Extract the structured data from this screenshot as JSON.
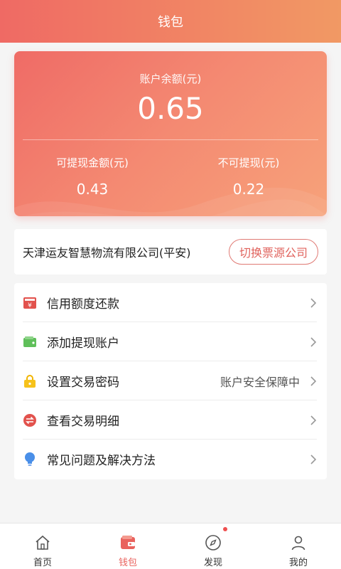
{
  "header": {
    "title": "钱包"
  },
  "card": {
    "balance_label": "账户余额(元)",
    "balance": "0.65",
    "withdrawable_label": "可提现金额(元)",
    "withdrawable": "0.43",
    "non_withdrawable_label": "不可提现(元)",
    "non_withdrawable": "0.22"
  },
  "company": {
    "name": "天津运友智慧物流有限公司(平安)",
    "switch_label": "切换票源公司"
  },
  "menu": {
    "items": [
      {
        "label": "信用额度还款",
        "icon": "credit-repay-icon",
        "extra": ""
      },
      {
        "label": "添加提现账户",
        "icon": "wallet-icon",
        "extra": ""
      },
      {
        "label": "设置交易密码",
        "icon": "lock-icon",
        "extra": "账户安全保障中"
      },
      {
        "label": "查看交易明细",
        "icon": "exchange-icon",
        "extra": ""
      },
      {
        "label": "常见问题及解决方法",
        "icon": "lightbulb-icon",
        "extra": ""
      }
    ]
  },
  "tabbar": {
    "items": [
      {
        "label": "首页",
        "icon": "home-icon"
      },
      {
        "label": "钱包",
        "icon": "wallet-tab-icon"
      },
      {
        "label": "发现",
        "icon": "compass-icon"
      },
      {
        "label": "我的",
        "icon": "profile-icon"
      }
    ],
    "active_index": 1
  },
  "colors": {
    "accent": "#e9625d",
    "header_start": "#ef6a64",
    "header_end": "#f19964"
  }
}
